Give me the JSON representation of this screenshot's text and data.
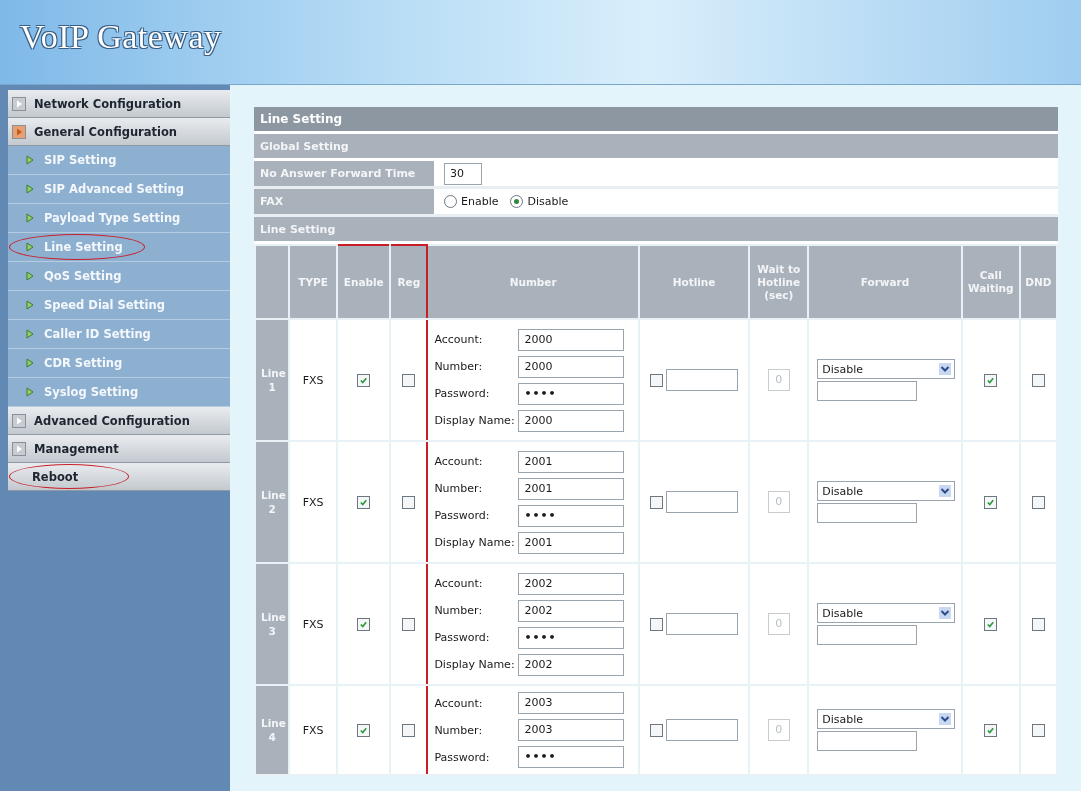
{
  "header": {
    "title": "VoIP Gateway"
  },
  "sidebar": {
    "items": [
      {
        "label": "Network Configuration",
        "expanded": false,
        "highlighted": false
      },
      {
        "label": "General Configuration",
        "expanded": true,
        "highlighted": false,
        "children": [
          {
            "label": "SIP Setting",
            "highlighted": false
          },
          {
            "label": "SIP Advanced Setting",
            "highlighted": false
          },
          {
            "label": "Payload Type Setting",
            "highlighted": false
          },
          {
            "label": "Line Setting",
            "highlighted": true
          },
          {
            "label": "QoS Setting",
            "highlighted": false
          },
          {
            "label": "Speed Dial Setting",
            "highlighted": false
          },
          {
            "label": "Caller ID Setting",
            "highlighted": false
          },
          {
            "label": "CDR Setting",
            "highlighted": false
          },
          {
            "label": "Syslog Setting",
            "highlighted": false
          }
        ]
      },
      {
        "label": "Advanced Configuration",
        "expanded": false,
        "highlighted": false
      },
      {
        "label": "Management",
        "expanded": false,
        "highlighted": false
      },
      {
        "label": "Reboot",
        "highlighted": true
      }
    ]
  },
  "panel_title": "Line Setting",
  "global": {
    "title": "Global Setting",
    "fields": [
      {
        "kind": "text",
        "label": "No Answer Forward Time",
        "value": "30"
      },
      {
        "kind": "radio",
        "label": "FAX",
        "options": [
          {
            "label": "Enable",
            "selected": false
          },
          {
            "label": "Disable",
            "selected": true
          }
        ]
      }
    ]
  },
  "lines": {
    "title": "Line Setting",
    "columns": [
      {
        "highlighted": false
      },
      {
        "label": "TYPE",
        "highlighted": false
      },
      {
        "label": "Enable",
        "highlighted": true
      },
      {
        "label": "Reg",
        "highlighted": true
      },
      {
        "label": "Number",
        "highlighted": false
      },
      {
        "label": "Hotline",
        "highlighted": false
      },
      {
        "label": "Wait to Hotline (sec)",
        "highlighted": false
      },
      {
        "label": "Forward",
        "highlighted": false
      },
      {
        "label": "Call Waiting",
        "highlighted": false
      },
      {
        "label": "DND",
        "highlighted": false
      }
    ],
    "rows": [
      {
        "line": "Line 1",
        "type": "FXS",
        "enable": true,
        "reg": false,
        "fields": [
          {
            "kind": "text",
            "label": "Account:",
            "value": "2000"
          },
          {
            "kind": "text",
            "label": "Number:",
            "value": "2000"
          },
          {
            "kind": "password",
            "label": "Password:",
            "value": "••••"
          },
          {
            "kind": "text",
            "label": "Display Name:",
            "value": "2000"
          }
        ],
        "hotline": false,
        "wait": "0",
        "forward": "Disable",
        "call_waiting": true,
        "dnd": false
      },
      {
        "line": "Line 2",
        "type": "FXS",
        "enable": true,
        "reg": false,
        "fields": [
          {
            "kind": "text",
            "label": "Account:",
            "value": "2001"
          },
          {
            "kind": "text",
            "label": "Number:",
            "value": "2001"
          },
          {
            "kind": "password",
            "label": "Password:",
            "value": "••••"
          },
          {
            "kind": "text",
            "label": "Display Name:",
            "value": "2001"
          }
        ],
        "hotline": false,
        "wait": "0",
        "forward": "Disable",
        "call_waiting": true,
        "dnd": false
      },
      {
        "line": "Line 3",
        "type": "FXS",
        "enable": true,
        "reg": false,
        "fields": [
          {
            "kind": "text",
            "label": "Account:",
            "value": "2002"
          },
          {
            "kind": "text",
            "label": "Number:",
            "value": "2002"
          },
          {
            "kind": "password",
            "label": "Password:",
            "value": "••••"
          },
          {
            "kind": "text",
            "label": "Display Name:",
            "value": "2002"
          }
        ],
        "hotline": false,
        "wait": "0",
        "forward": "Disable",
        "call_waiting": true,
        "dnd": false
      },
      {
        "line": "Line 4",
        "type": "FXS",
        "enable": true,
        "reg": false,
        "fields": [
          {
            "kind": "text",
            "label": "Account:",
            "value": "2003"
          },
          {
            "kind": "text",
            "label": "Number:",
            "value": "2003"
          },
          {
            "kind": "password",
            "label": "Password:",
            "value": "••••"
          }
        ],
        "hotline": false,
        "wait": "0",
        "forward": "Disable",
        "call_waiting": true,
        "dnd": false
      }
    ]
  }
}
